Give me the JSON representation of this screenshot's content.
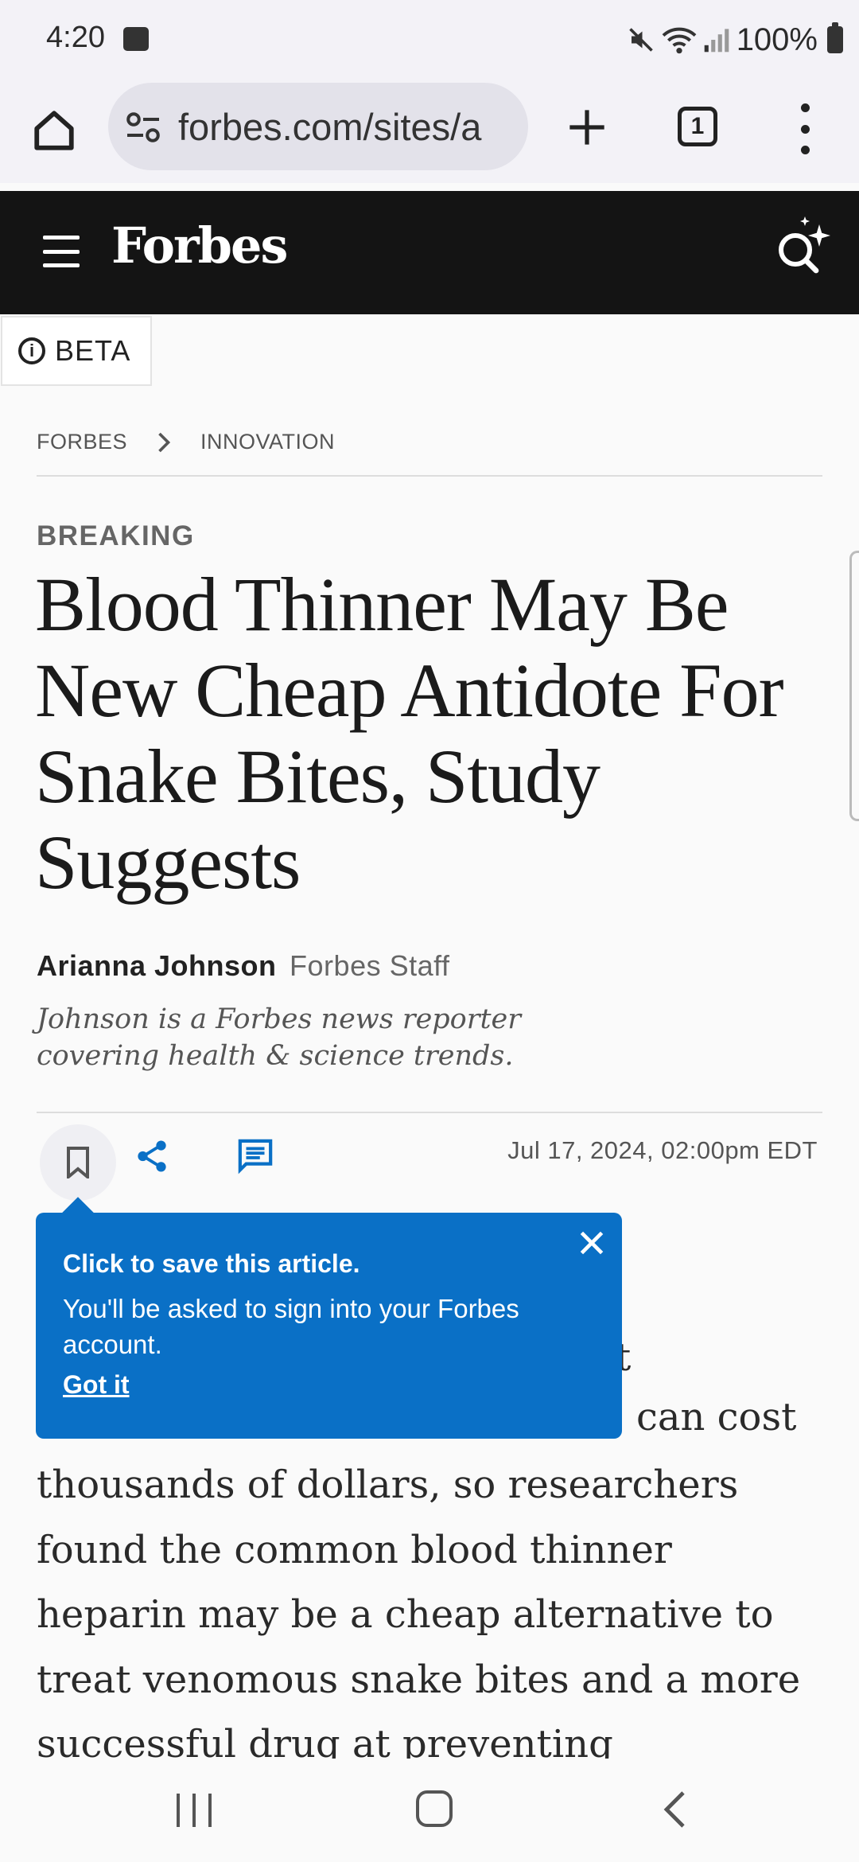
{
  "status_bar": {
    "time": "4:20",
    "battery": "100%"
  },
  "browser": {
    "url": "forbes.com/sites/a",
    "tab_count": "1",
    "load_progress": 0.7
  },
  "site": {
    "logo": "Forbes"
  },
  "beta": {
    "label": "BETA"
  },
  "breadcrumb": [
    "FORBES",
    "INNOVATION"
  ],
  "article": {
    "kicker": "BREAKING",
    "headline": "Blood Thinner May Be New Cheap Antidote For Snake Bites, Study Suggests",
    "author_name": "Arianna Johnson",
    "author_role": "Forbes Staff",
    "author_bio": "Johnson is a Forbes news reporter covering health & science trends.",
    "date": "Jul 17, 2024, 02:00pm EDT",
    "body_lines": [
      "t",
      "can cost",
      "thousands of dollars, so researchers",
      "found the common blood thinner",
      "heparin may be a cheap alternative to",
      "treat venomous snake bites and a more",
      "successful drug at preventing"
    ]
  },
  "tooltip": {
    "title": "Click to save this article.",
    "text": "You'll be asked to sign into your Forbes account.",
    "link": "Got it"
  },
  "colors": {
    "header_bg": "#141414",
    "accent": "#0a70c6",
    "browser_bg": "#f3f2f7"
  }
}
